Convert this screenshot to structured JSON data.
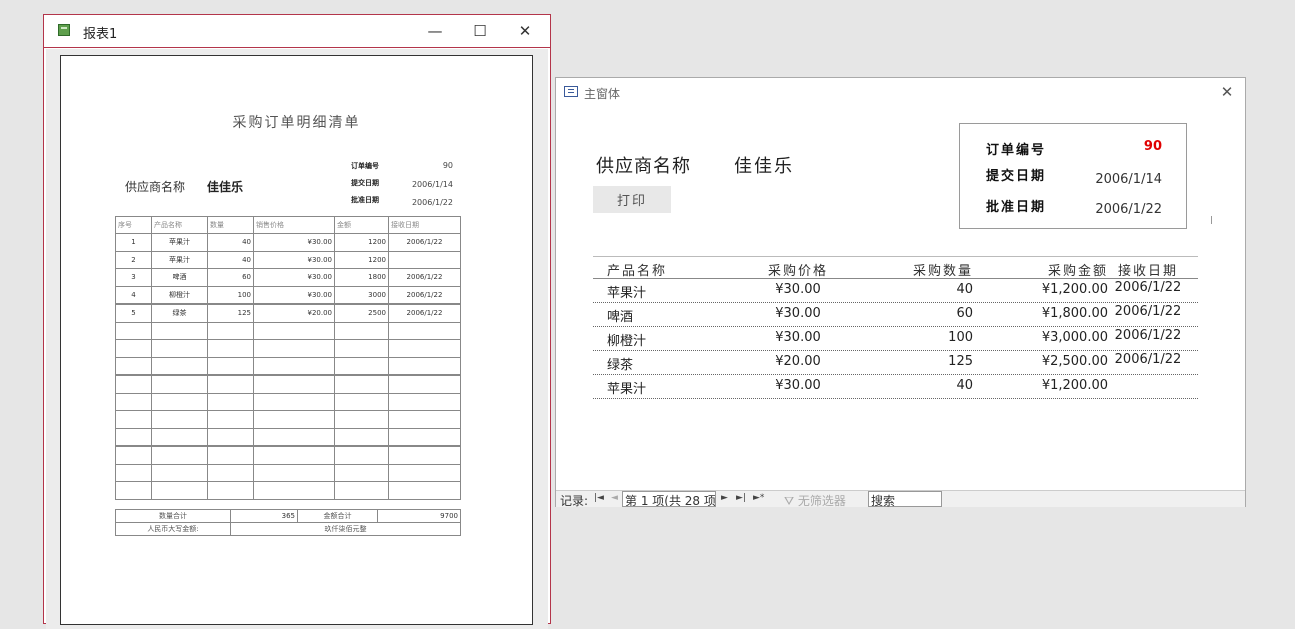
{
  "report": {
    "window_title": "报表1",
    "window_buttons": {
      "minimize": "—",
      "maximize": "☐",
      "close": "✕"
    },
    "title": "采购订单明细清单",
    "supplier_label": "供应商名称",
    "supplier_name": "佳佳乐",
    "order_no_label": "订单编号",
    "order_no": "90",
    "submit_date_label": "提交日期",
    "submit_date": "2006/1/14",
    "approve_date_label": "批准日期",
    "approve_date": "2006/1/22",
    "columns": [
      "序号",
      "产品名称",
      "数量",
      "销售价格",
      "金额",
      "接收日期"
    ],
    "rows": [
      [
        "1",
        "苹果汁",
        "40",
        "¥30.00",
        "1200",
        "2006/1/22"
      ],
      [
        "2",
        "苹果汁",
        "40",
        "¥30.00",
        "1200",
        ""
      ],
      [
        "3",
        "啤酒",
        "60",
        "¥30.00",
        "1800",
        "2006/1/22"
      ],
      [
        "4",
        "柳橙汁",
        "100",
        "¥30.00",
        "3000",
        "2006/1/22"
      ],
      [
        "5",
        "绿茶",
        "125",
        "¥20.00",
        "2500",
        "2006/1/22"
      ]
    ],
    "empty_rows": 10,
    "qty_total_label": "数量合计",
    "qty_total": "365",
    "amount_total_label": "金额合计",
    "amount_total": "9700",
    "rmb_label": "人民币大写金额:",
    "rmb_value": "玖仟柒佰元整"
  },
  "form": {
    "window_title": "主窗体",
    "close": "✕",
    "supplier_label": "供应商名称",
    "supplier_name": "佳佳乐",
    "print_button": "打印",
    "order_no_label": "订单编号",
    "order_no": "90",
    "submit_date_label": "提交日期",
    "submit_date": "2006/1/14",
    "approve_date_label": "批准日期",
    "approve_date": "2006/1/22",
    "columns": [
      "产品名称",
      "采购价格",
      "采购数量",
      "采购金额",
      "接收日期"
    ],
    "rows": [
      [
        "苹果汁",
        "¥30.00",
        "40",
        "¥1,200.00",
        "2006/1/22"
      ],
      [
        "啤酒",
        "¥30.00",
        "60",
        "¥1,800.00",
        "2006/1/22"
      ],
      [
        "柳橙汁",
        "¥30.00",
        "100",
        "¥3,000.00",
        "2006/1/22"
      ],
      [
        "绿茶",
        "¥20.00",
        "125",
        "¥2,500.00",
        "2006/1/22"
      ],
      [
        "苹果汁",
        "¥30.00",
        "40",
        "¥1,200.00",
        ""
      ]
    ],
    "nav": {
      "record_label": "记录:",
      "first": "|◄",
      "prev": "◄",
      "position": "第 1 项(共 28 项",
      "next": "►",
      "last": "►|",
      "new": "►*",
      "filter": "无筛选器",
      "search": "搜索"
    }
  },
  "colors": {
    "report_border": "#b3354a",
    "order_no_red": "#e00000"
  }
}
